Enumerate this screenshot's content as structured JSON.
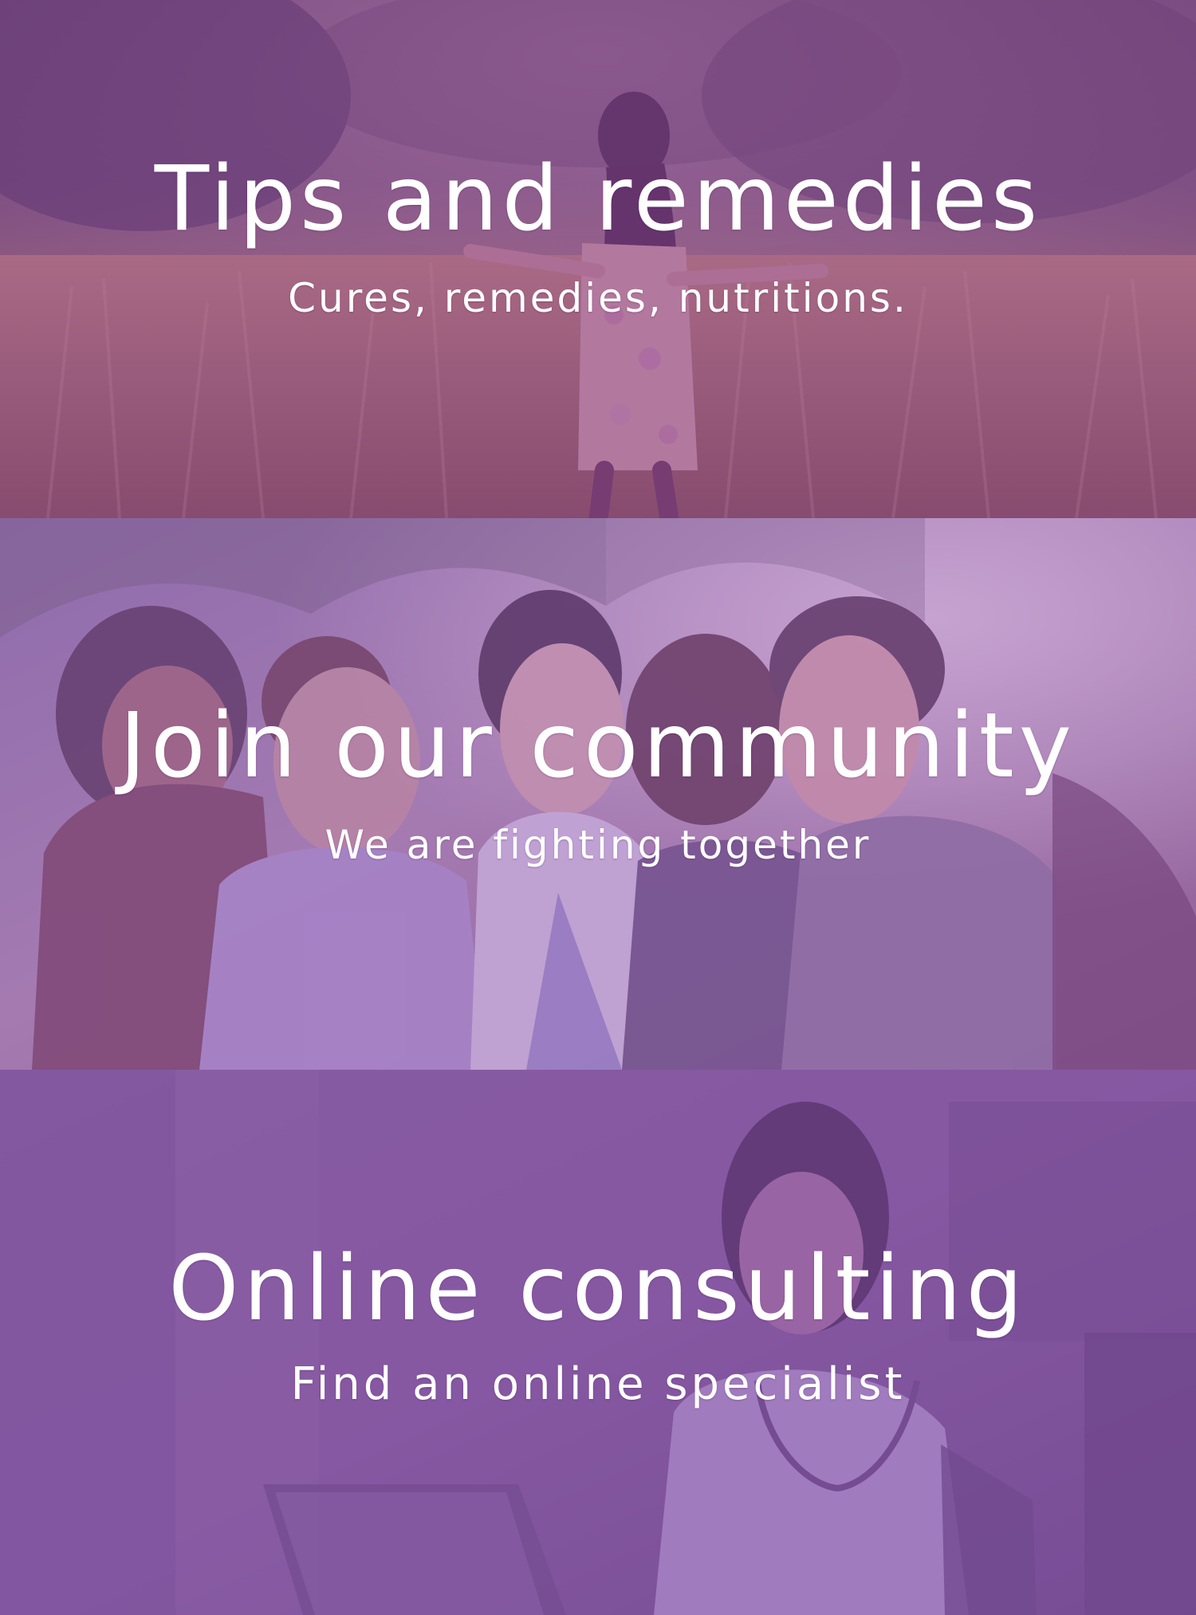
{
  "sections": [
    {
      "title": "Tips and remedies",
      "subtitle": "Cures, remedies, nutritions."
    },
    {
      "title": "Join our community",
      "subtitle": "We are fighting together"
    },
    {
      "title": "Online consulting",
      "subtitle": "Find an online specialist"
    }
  ],
  "colors": {
    "overlay_primary": "#8a4cab",
    "overlay_secondary": "#9a63bd",
    "text": "#ffffff"
  }
}
